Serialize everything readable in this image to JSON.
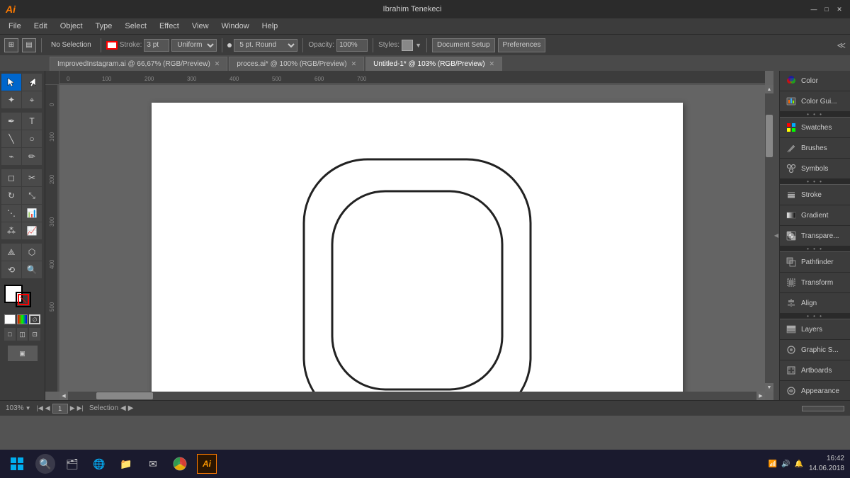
{
  "titlebar": {
    "ai_logo": "Ai",
    "user": "Ibrahim Tenekeci",
    "win_controls": [
      "—",
      "□",
      "✕"
    ]
  },
  "menubar": {
    "items": [
      "File",
      "Edit",
      "Object",
      "Type",
      "Select",
      "Effect",
      "View",
      "Window",
      "Help"
    ]
  },
  "toolbar": {
    "no_selection": "No Selection",
    "stroke_label": "Stroke:",
    "stroke_value": "3 pt",
    "uniform_label": "Uniform",
    "dot_label": "5 pt. Round",
    "opacity_label": "Opacity:",
    "opacity_value": "100%",
    "styles_label": "Styles:",
    "doc_setup_btn": "Document Setup",
    "prefs_btn": "Preferences"
  },
  "tabs": [
    {
      "label": "ImprovedInstagram.ai @ 66,67% (RGB/Preview)",
      "active": false
    },
    {
      "label": "proces.ai* @ 100% (RGB/Preview)",
      "active": false
    },
    {
      "label": "Untitled-1* @ 103% (RGB/Preview)",
      "active": true
    }
  ],
  "right_panel": {
    "items": [
      {
        "name": "Color",
        "icon": "color-icon"
      },
      {
        "name": "Color Gui...",
        "icon": "color-guide-icon"
      },
      {
        "name": "Swatches",
        "icon": "swatches-icon"
      },
      {
        "name": "Brushes",
        "icon": "brushes-icon"
      },
      {
        "name": "Symbols",
        "icon": "symbols-icon"
      },
      {
        "name": "Stroke",
        "icon": "stroke-icon"
      },
      {
        "name": "Gradient",
        "icon": "gradient-icon"
      },
      {
        "name": "Transpare...",
        "icon": "transparency-icon"
      },
      {
        "name": "Pathfinder",
        "icon": "pathfinder-icon"
      },
      {
        "name": "Transform",
        "icon": "transform-icon"
      },
      {
        "name": "Align",
        "icon": "align-icon"
      },
      {
        "name": "Layers",
        "icon": "layers-icon"
      },
      {
        "name": "Graphic S...",
        "icon": "graphic-styles-icon"
      },
      {
        "name": "Artboards",
        "icon": "artboards-icon"
      },
      {
        "name": "Appearance",
        "icon": "appearance-icon"
      }
    ]
  },
  "statusbar": {
    "zoom": "103%",
    "artboard_label": "Selection",
    "artboard_num": "1"
  },
  "taskbar": {
    "time": "16:42",
    "date": "14.06.2018",
    "icons": [
      "⊞",
      "🔍",
      "🗂",
      "🌐",
      "📁",
      "✉",
      "🌀",
      "🟠"
    ]
  }
}
